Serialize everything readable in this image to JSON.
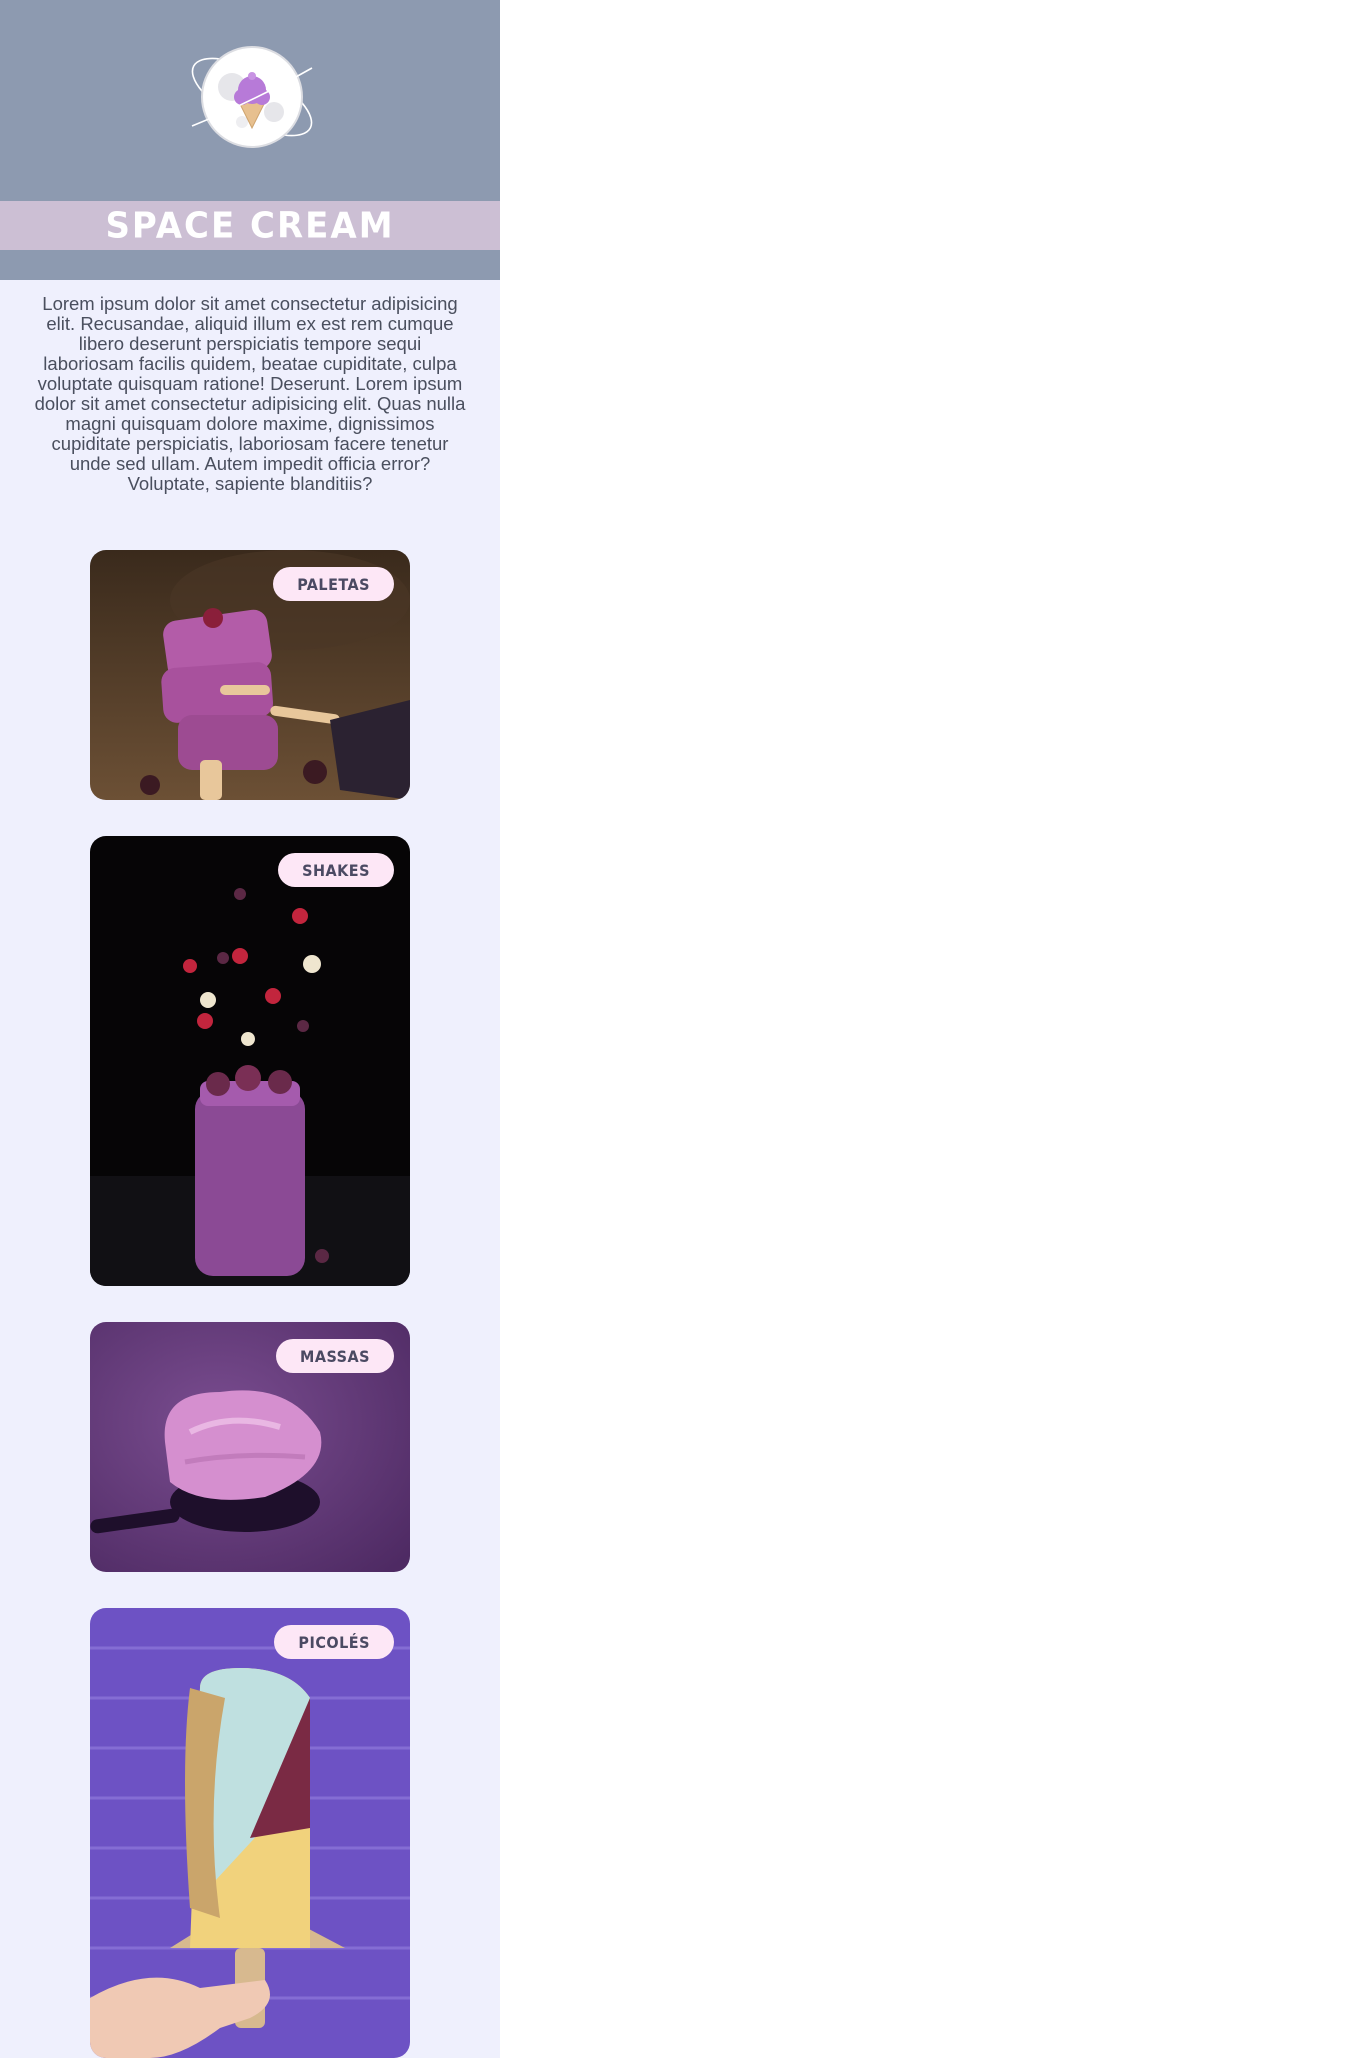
{
  "brand": {
    "title": "SPACE CREAM",
    "logo_icon": "ice-cream-planet-icon"
  },
  "intro_text": "Lorem ipsum dolor sit amet consectetur adipisicing elit. Recusandae, aliquid illum ex est rem cumque libero deserunt perspiciatis tempore sequi laboriosam facilis quidem, beatae cupiditate, culpa voluptate quisquam ratione! Deserunt. Lorem ipsum dolor sit amet consectetur adipisicing elit. Quas nulla magni quisquam dolore maxime, dignissimos cupiditate perspiciatis, laboriosam facere tenetur unde sed ullam. Autem impedit officia error? Voluptate, sapiente blanditiis?",
  "categories": [
    {
      "label": "PALETAS"
    },
    {
      "label": "SHAKES"
    },
    {
      "label": "MASSAS"
    },
    {
      "label": "PICOLÉS"
    }
  ],
  "colors": {
    "header_bg": "#8d9ab0",
    "title_band": "#ccbfd4",
    "page_bg": "#eff0fd",
    "badge_bg": "#fde7f6",
    "badge_text": "#4b4a63"
  }
}
